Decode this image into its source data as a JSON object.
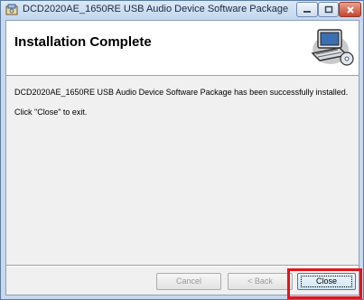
{
  "window": {
    "title": "DCD2020AE_1650RE USB Audio Device Software Package",
    "icon": "installer-icon",
    "controls": {
      "minimize": "minimize-icon",
      "maximize": "maximize-icon",
      "close": "close-icon"
    }
  },
  "banner": {
    "title": "Installation Complete",
    "icon": "computer-cd-icon"
  },
  "body": {
    "message": "DCD2020AE_1650RE USB Audio Device Software Package has been successfully installed.",
    "instruction": "Click \"Close\" to exit."
  },
  "buttons": {
    "cancel": "Cancel",
    "back": "< Back",
    "close": "Close"
  },
  "colors": {
    "highlight": "#e0161c",
    "title_close_button": "#c8452c"
  }
}
